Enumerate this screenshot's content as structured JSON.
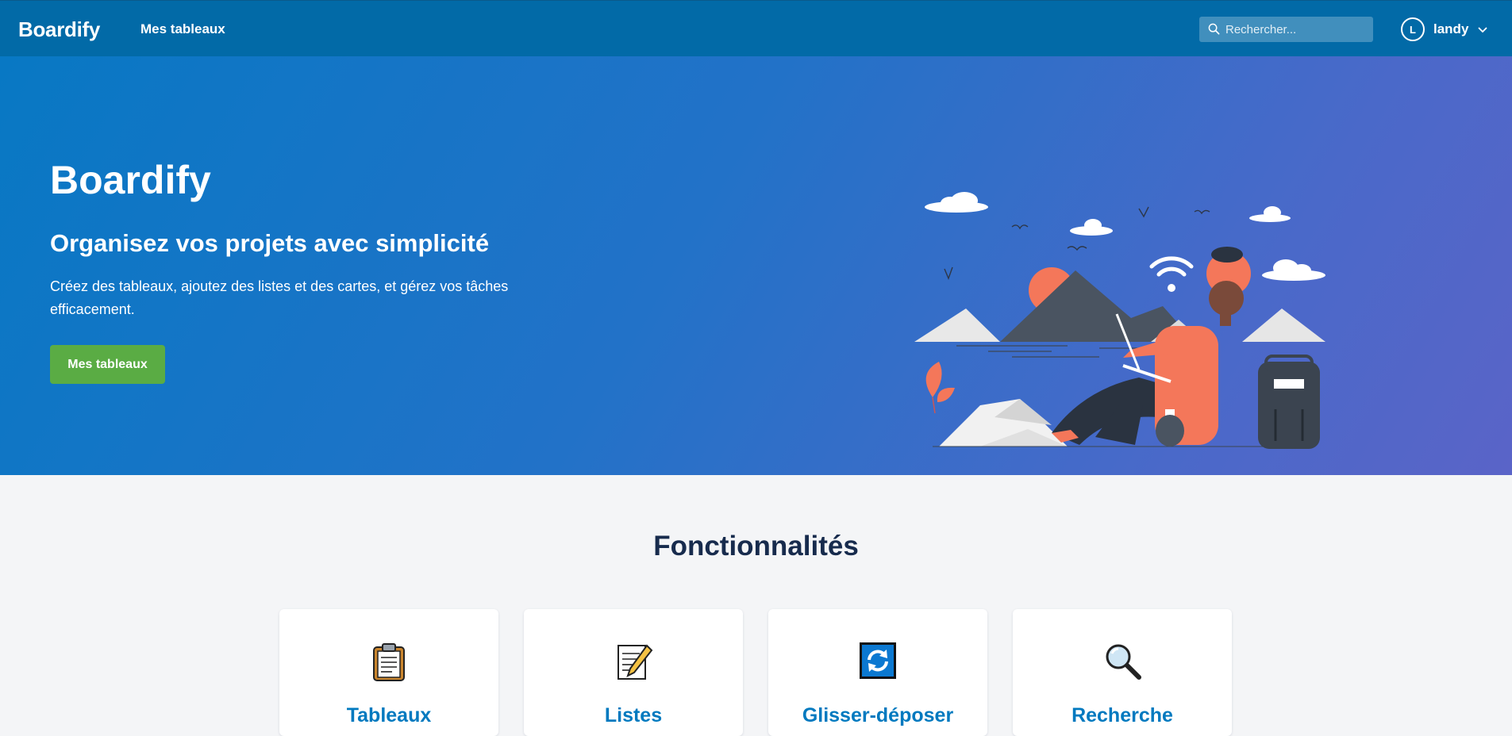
{
  "topbar": {
    "brand": "Boardify",
    "nav_link": "Mes tableaux",
    "search_placeholder": "Rechercher...",
    "user": {
      "initial": "L",
      "name": "landy"
    }
  },
  "hero": {
    "title": "Boardify",
    "subtitle": "Organisez vos projets avec simplicité",
    "description": "Créez des tableaux, ajoutez des listes et des cartes, et gérez vos tâches efficacement.",
    "button_label": "Mes tableaux"
  },
  "features": {
    "title": "Fonctionnalités",
    "cards": [
      {
        "icon": "clipboard-icon",
        "title": "Tableaux"
      },
      {
        "icon": "memo-icon",
        "title": "Listes"
      },
      {
        "icon": "refresh-icon",
        "title": "Glisser-déposer"
      },
      {
        "icon": "magnifier-icon",
        "title": "Recherche"
      }
    ]
  },
  "colors": {
    "topbar": "#026aa7",
    "button_green": "#5aac44",
    "card_title": "#0079bf",
    "heading_dark": "#172b4d"
  }
}
